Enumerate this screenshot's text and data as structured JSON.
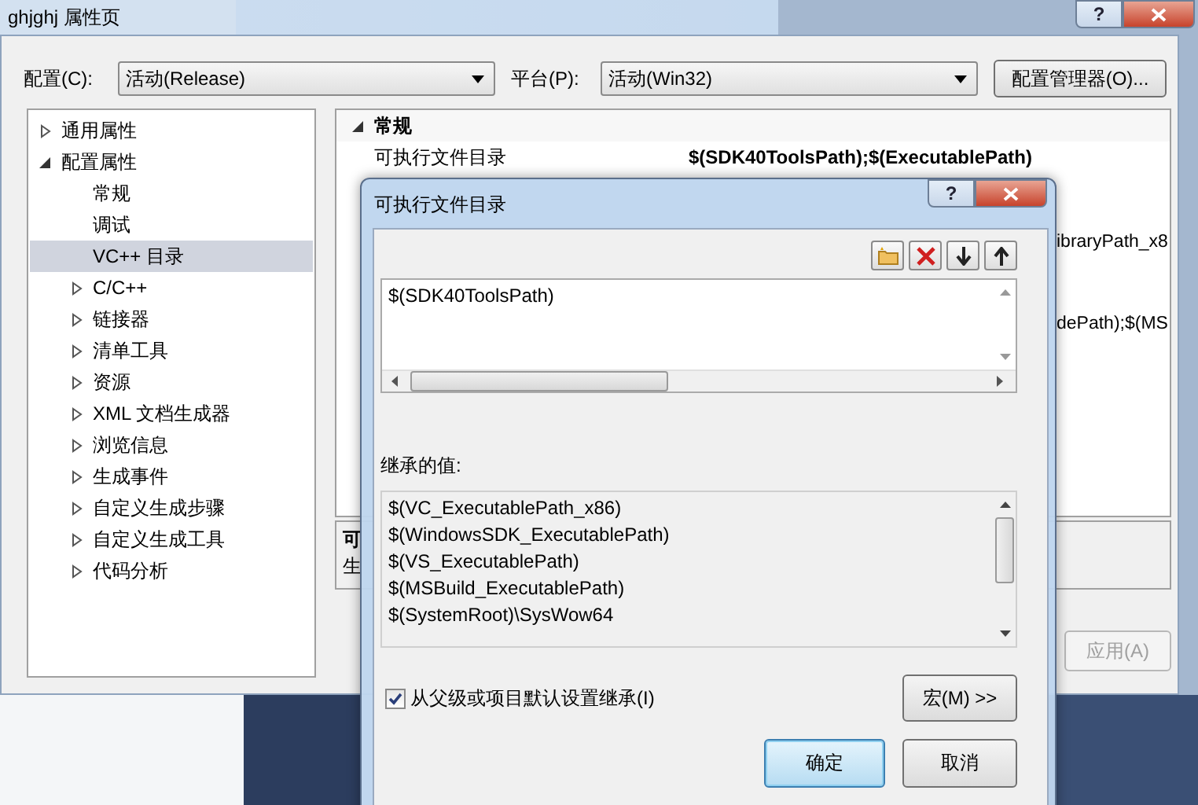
{
  "window": {
    "title": "ghjghj 属性页",
    "help_glyph": "?"
  },
  "config": {
    "label": "配置(C):",
    "value": "活动(Release)"
  },
  "platform": {
    "label": "平台(P):",
    "value": "活动(Win32)"
  },
  "config_manager_button": "配置管理器(O)...",
  "tree": [
    {
      "label": "通用属性",
      "expanded": false,
      "selected": false
    },
    {
      "label": "配置属性",
      "expanded": true,
      "selected": false,
      "children": [
        {
          "label": "常规",
          "selected": false
        },
        {
          "label": "调试",
          "selected": false
        },
        {
          "label": "VC++ 目录",
          "selected": true
        },
        {
          "label": "C/C++",
          "expanded": false,
          "selected": false
        },
        {
          "label": "链接器",
          "expanded": false,
          "selected": false
        },
        {
          "label": "清单工具",
          "expanded": false,
          "selected": false
        },
        {
          "label": "资源",
          "expanded": false,
          "selected": false
        },
        {
          "label": "XML 文档生成器",
          "expanded": false,
          "selected": false
        },
        {
          "label": "浏览信息",
          "expanded": false,
          "selected": false
        },
        {
          "label": "生成事件",
          "expanded": false,
          "selected": false
        },
        {
          "label": "自定义生成步骤",
          "expanded": false,
          "selected": false
        },
        {
          "label": "自定义生成工具",
          "expanded": false,
          "selected": false
        },
        {
          "label": "代码分析",
          "expanded": false,
          "selected": false
        }
      ]
    }
  ],
  "property_grid": {
    "category": {
      "label": "常规",
      "expanded": true
    },
    "rows": [
      {
        "name": "可执行文件目录",
        "value": "$(SDK40ToolsPath);$(ExecutablePath)"
      }
    ],
    "partial_values": [
      "ibraryPath_x8",
      "dePath);$(MS"
    ]
  },
  "description": {
    "title": "可",
    "text": "生"
  },
  "apply_button": {
    "label": "应用(A)",
    "disabled": true
  },
  "dialog": {
    "title": "可执行文件目录",
    "help_glyph": "?",
    "entries": [
      "$(SDK40ToolsPath)"
    ],
    "inherited_label": "继承的值:",
    "inherited": [
      "$(VC_ExecutablePath_x86)",
      "$(WindowsSDK_ExecutablePath)",
      "$(VS_ExecutablePath)",
      "$(MSBuild_ExecutablePath)",
      "$(SystemRoot)\\SysWow64"
    ],
    "inherit_checkbox": {
      "label": "从父级或项目默认设置继承(I)",
      "checked": true
    },
    "macro_button": "宏(M) >>",
    "ok_button": "确定",
    "cancel_button": "取消"
  }
}
